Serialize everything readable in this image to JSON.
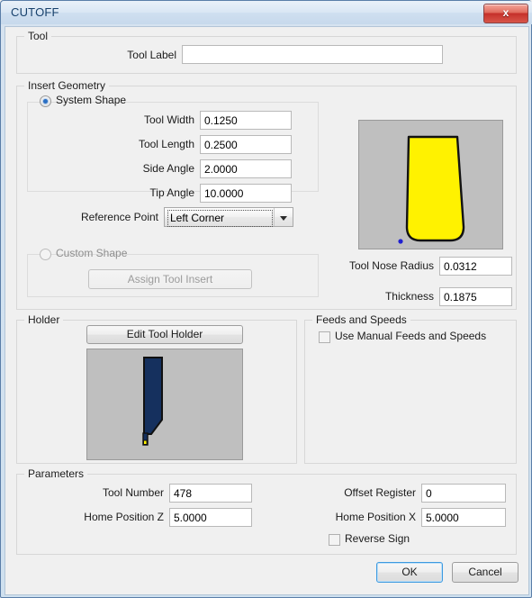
{
  "window": {
    "title": "CUTOFF",
    "close_label": "x"
  },
  "tool_group": {
    "legend": "Tool",
    "tool_label_label": "Tool Label",
    "tool_label_value": "",
    "tool_label_placeholder": ""
  },
  "insert_geometry": {
    "legend": "Insert Geometry",
    "system_shape_label": "System Shape",
    "system_shape_selected": true,
    "custom_shape_label": "Custom Shape",
    "custom_shape_selected": false,
    "assign_tool_insert_label": "Assign Tool Insert",
    "fields": [
      {
        "label": "Tool Width",
        "value": "0.1250"
      },
      {
        "label": "Tool Length",
        "value": "0.2500"
      },
      {
        "label": "Side Angle",
        "value": "2.0000"
      },
      {
        "label": "Tip Angle",
        "value": "10.0000"
      }
    ],
    "reference_point_label": "Reference Point",
    "reference_point_value": "Left Corner",
    "tool_nose_radius_label": "Tool Nose Radius",
    "tool_nose_radius_value": "0.0312",
    "thickness_label": "Thickness",
    "thickness_value": "0.1875",
    "preview_insert_color": "#FFF200",
    "preview_background": "#BFBFBF",
    "preview_reference_dot_color": "#2020D0"
  },
  "holder": {
    "legend": "Holder",
    "edit_button_label": "Edit Tool Holder",
    "preview_holder_color": "#15305E",
    "preview_insert_color": "#FFF200",
    "preview_background": "#BFBFBF"
  },
  "feeds_and_speeds": {
    "legend": "Feeds and Speeds",
    "use_manual_label": "Use Manual Feeds and Speeds",
    "use_manual_checked": false
  },
  "parameters": {
    "legend": "Parameters",
    "tool_number_label": "Tool Number",
    "tool_number_value": "478",
    "home_position_z_label": "Home Position Z",
    "home_position_z_value": "5.0000",
    "offset_register_label": "Offset Register",
    "offset_register_value": "0",
    "home_position_x_label": "Home Position X",
    "home_position_x_value": "5.0000",
    "reverse_sign_label": "Reverse Sign",
    "reverse_sign_checked": false
  },
  "footer": {
    "ok_label": "OK",
    "cancel_label": "Cancel"
  }
}
